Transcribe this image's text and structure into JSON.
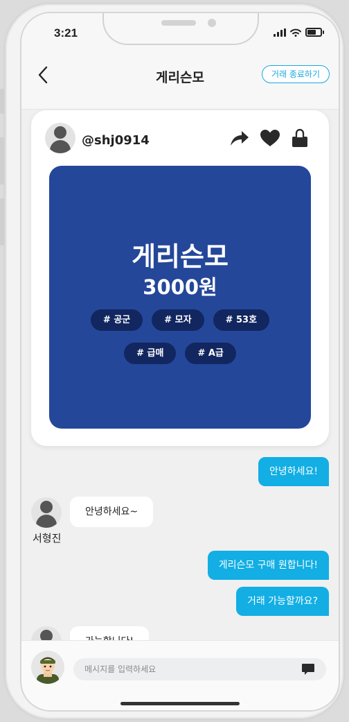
{
  "status_bar": {
    "time": "3:21"
  },
  "header": {
    "title": "게리슨모",
    "end_trade_label": "거래 종료하기"
  },
  "product_card": {
    "seller": "@shj0914",
    "name": "게리슨모",
    "price": "3000원",
    "tags": [
      "# 공군",
      "# 모자",
      "# 53호",
      "# 급매",
      "# A급"
    ],
    "image_color": "#24479a"
  },
  "messages": [
    {
      "side": "right",
      "text": "안녕하세요!"
    },
    {
      "side": "left",
      "sender": "서형진",
      "text": "안녕하세요~"
    },
    {
      "side": "right",
      "text": "게리슨모 구매 원합니다!"
    },
    {
      "side": "right",
      "text": "거래 가능할까요?"
    },
    {
      "side": "left",
      "text": "가능합니다!"
    }
  ],
  "input": {
    "placeholder": "메시지를 입력하세요"
  },
  "colors": {
    "accent": "#12aee4",
    "tag": "#122660"
  }
}
